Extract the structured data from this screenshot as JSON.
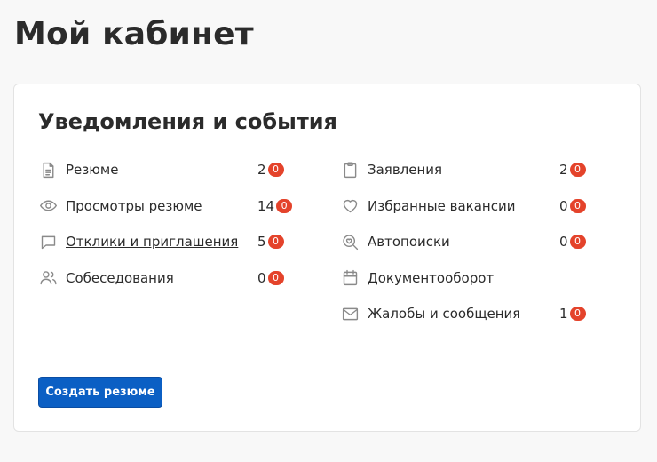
{
  "page": {
    "title": "Мой кабинет"
  },
  "card": {
    "title": "Уведомления и события",
    "left": [
      {
        "icon": "document-icon",
        "label": "Резюме",
        "count": "2",
        "badge": "0",
        "link": false
      },
      {
        "icon": "eye-icon",
        "label": "Просмотры резюме",
        "count": "14",
        "badge": "0",
        "link": false
      },
      {
        "icon": "chat-bubble-icon",
        "label": "Отклики и приглашения",
        "count": "5",
        "badge": "0",
        "link": true
      },
      {
        "icon": "people-icon",
        "label": "Собеседования",
        "count": "0",
        "badge": "0",
        "link": false
      }
    ],
    "right": [
      {
        "icon": "clipboard-icon",
        "label": "Заявления",
        "count": "2",
        "badge": "0"
      },
      {
        "icon": "heart-icon",
        "label": "Избранные вакансии",
        "count": "0",
        "badge": "0"
      },
      {
        "icon": "search-heart-icon",
        "label": "Автопоиски",
        "count": "0",
        "badge": "0"
      },
      {
        "icon": "calendar-icon",
        "label": "Документооборот",
        "count": "",
        "badge": ""
      },
      {
        "icon": "mail-icon",
        "label": "Жалобы и сообщения",
        "count": "1",
        "badge": "0"
      }
    ],
    "create_button": "Создать резюме"
  },
  "colors": {
    "accent": "#0b5fc4",
    "badge": "#e4432b",
    "icon": "#8a8a8a"
  }
}
